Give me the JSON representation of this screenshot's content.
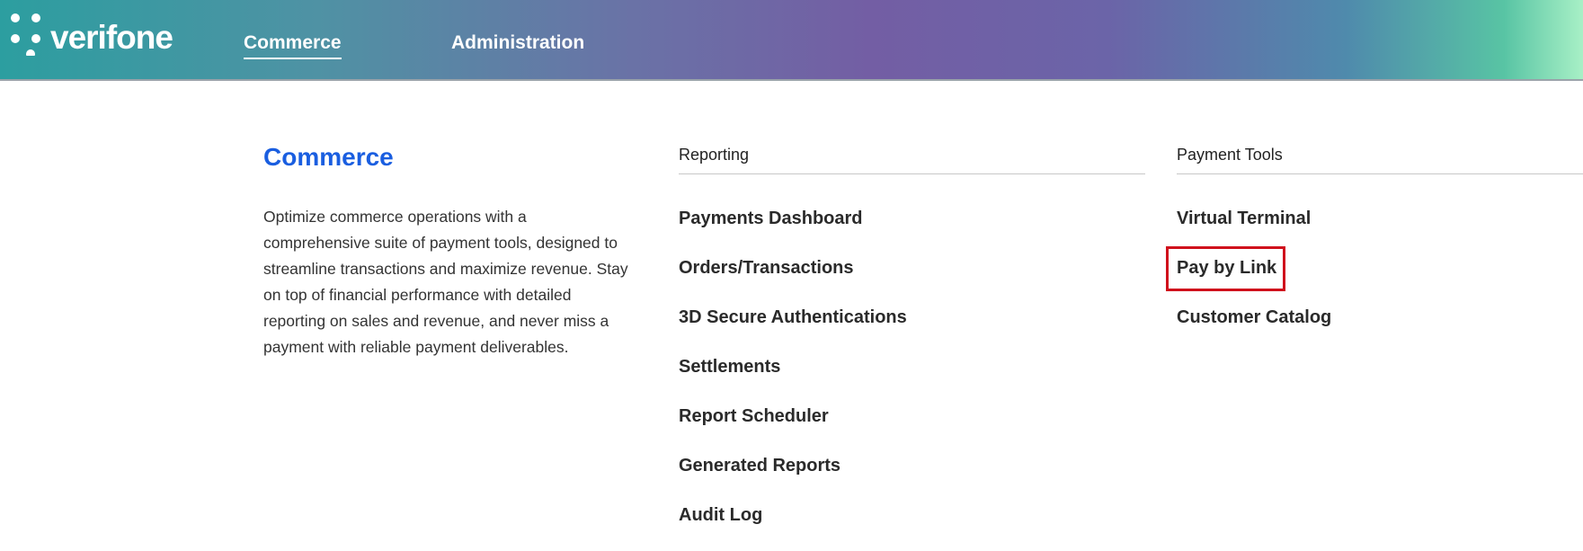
{
  "header": {
    "logo_text": "verifone",
    "logo_icon": "verifone-dots-logo",
    "nav": [
      {
        "label": "Commerce",
        "active": true
      },
      {
        "label": "Administration",
        "active": false
      }
    ]
  },
  "main": {
    "title": "Commerce",
    "description": "Optimize commerce operations with a comprehensive suite of payment tools, designed to streamline transactions and maximize revenue. Stay on top of financial performance with detailed reporting on sales and revenue, and never miss a payment with reliable payment deliverables.",
    "reporting": {
      "header": "Reporting",
      "links": [
        "Payments Dashboard",
        "Orders/Transactions",
        "3D Secure Authentications",
        "Settlements",
        "Report Scheduler",
        "Generated Reports",
        "Audit Log"
      ]
    },
    "payment_tools": {
      "header": "Payment Tools",
      "links": [
        "Virtual Terminal",
        "Pay by Link",
        "Customer Catalog"
      ],
      "highlighted": "Pay by Link"
    }
  },
  "colors": {
    "title_blue": "#1a5ee0",
    "highlight_red": "#d0101c",
    "text_dark": "#2a2a2a"
  }
}
